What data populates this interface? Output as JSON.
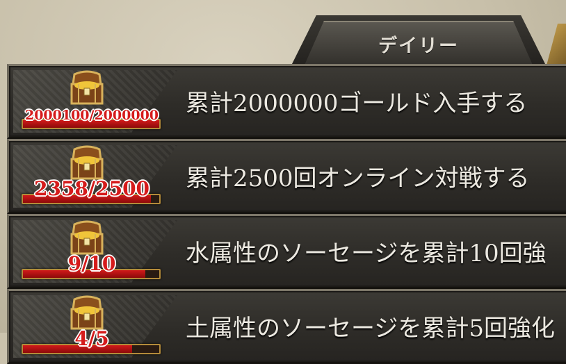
{
  "tab": {
    "label": "デイリー"
  },
  "missions": [
    {
      "progress_text": "2000100/2000000",
      "progress_fraction": 1.0,
      "title": "累計2000000ゴールド入手する"
    },
    {
      "progress_text": "2358/2500",
      "progress_fraction": 0.94,
      "title": "累計2500回オンライン対戦する"
    },
    {
      "progress_text": "9/10",
      "progress_fraction": 0.9,
      "title": "水属性のソーセージを累計10回強"
    },
    {
      "progress_text": "4/5",
      "progress_fraction": 0.8,
      "title": "土属性のソーセージを累計5回強化"
    }
  ],
  "colors": {
    "progress_red": "#c81414",
    "frame_gold": "#b48b3a",
    "row_dark": "#2e2c28"
  },
  "icons": {
    "reward": "treasure-chest-icon"
  }
}
